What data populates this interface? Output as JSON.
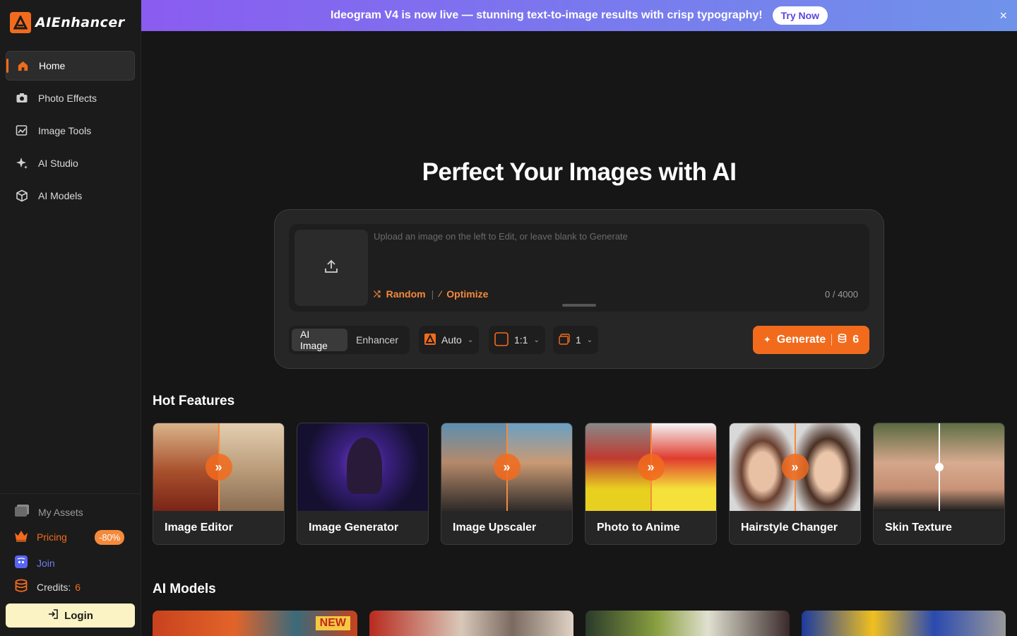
{
  "app": {
    "brand": "AIEnhancer",
    "accent": "#f26b1d"
  },
  "banner": {
    "text": "Ideogram V4 is now live — stunning text-to-image results with crisp typography!",
    "cta": "Try Now",
    "close": "×"
  },
  "sidebar": {
    "items": [
      {
        "label": "Home",
        "icon": "home-icon"
      },
      {
        "label": "Photo Effects",
        "icon": "camera-icon"
      },
      {
        "label": "Image Tools",
        "icon": "image-edit-icon"
      },
      {
        "label": "AI Studio",
        "icon": "sparkle-icon"
      },
      {
        "label": "AI Models",
        "icon": "cube-icon"
      }
    ],
    "bottom": {
      "assets": "My Assets",
      "pricing": "Pricing",
      "pricing_badge": "-80%",
      "join": "Join",
      "credits_label": "Credits:",
      "credits_value": "6",
      "login": "Login"
    }
  },
  "hero": {
    "title": "Perfect Your Images with AI"
  },
  "prompt": {
    "placeholder": "Upload an image on the left to Edit, or leave blank to Generate",
    "random": "Random",
    "optimize": "Optimize",
    "counter": "0 / 4000"
  },
  "controls": {
    "tabs": [
      "AI Image",
      "Enhancer"
    ],
    "model": "Auto",
    "ratio": "1:1",
    "count": "1",
    "generate": "Generate",
    "cost": "6"
  },
  "hot_features": {
    "title": "Hot Features",
    "cards": [
      {
        "label": "Image Editor"
      },
      {
        "label": "Image Generator"
      },
      {
        "label": "Image Upscaler"
      },
      {
        "label": "Photo to Anime"
      },
      {
        "label": "Hairstyle Changer"
      },
      {
        "label": "Skin Texture"
      }
    ]
  },
  "ai_models": {
    "title": "AI Models",
    "new_badge": "NEW"
  }
}
